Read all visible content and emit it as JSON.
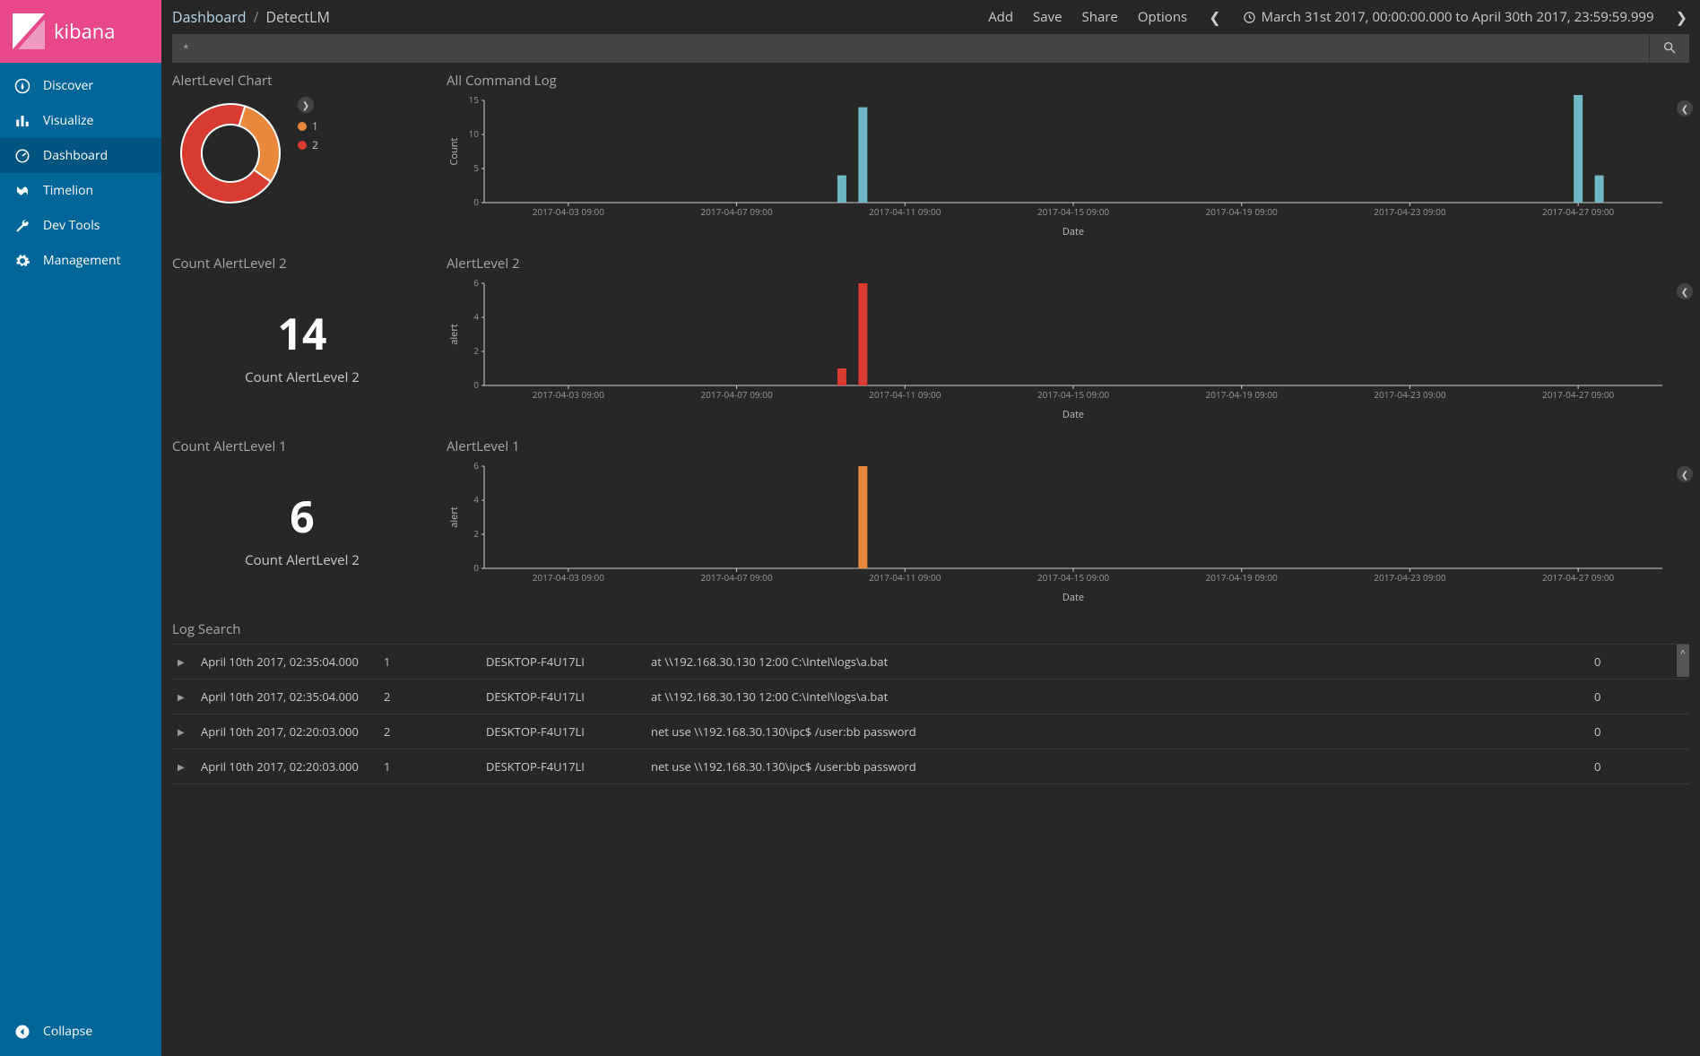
{
  "brand": "kibana",
  "nav": {
    "items": [
      {
        "label": "Discover",
        "icon": "compass"
      },
      {
        "label": "Visualize",
        "icon": "barchart"
      },
      {
        "label": "Dashboard",
        "icon": "dashboard",
        "active": true
      },
      {
        "label": "Timelion",
        "icon": "timelion"
      },
      {
        "label": "Dev Tools",
        "icon": "wrench"
      },
      {
        "label": "Management",
        "icon": "gear"
      }
    ],
    "collapse": "Collapse"
  },
  "breadcrumb": {
    "root": "Dashboard",
    "current": "DetectLM"
  },
  "top_actions": [
    "Add",
    "Save",
    "Share",
    "Options"
  ],
  "timerange": "March 31st 2017, 00:00:00.000 to April 30th 2017, 23:59:59.999",
  "search": {
    "value": "*"
  },
  "panels": {
    "donut": {
      "title": "AlertLevel Chart",
      "legend": [
        {
          "label": "1",
          "color": "#e9873c"
        },
        {
          "label": "2",
          "color": "#d93b30"
        }
      ]
    },
    "all_cmd": {
      "title": "All Command Log",
      "ylabel": "Count",
      "xlabel": "Date"
    },
    "count2": {
      "title": "Count AlertLevel 2",
      "value": "14",
      "label": "Count AlertLevel 2"
    },
    "alert2": {
      "title": "AlertLevel 2",
      "ylabel": "alert",
      "xlabel": "Date"
    },
    "count1": {
      "title": "Count AlertLevel 1",
      "value": "6",
      "label": "Count AlertLevel 2"
    },
    "alert1": {
      "title": "AlertLevel 1",
      "ylabel": "alert",
      "xlabel": "Date"
    },
    "log": {
      "title": "Log Search",
      "rows": [
        {
          "time": "April 10th 2017, 02:35:04.000",
          "level": "1",
          "host": "DESKTOP-F4U17LI",
          "cmd": "at \\\\192.168.30.130 12:00 C:\\Intel\\logs\\a.bat",
          "n": "0"
        },
        {
          "time": "April 10th 2017, 02:35:04.000",
          "level": "2",
          "host": "DESKTOP-F4U17LI",
          "cmd": "at \\\\192.168.30.130 12:00 C:\\Intel\\logs\\a.bat",
          "n": "0"
        },
        {
          "time": "April 10th 2017, 02:20:03.000",
          "level": "2",
          "host": "DESKTOP-F4U17LI",
          "cmd": "net use \\\\192.168.30.130\\ipc$ /user:bb password",
          "n": "0"
        },
        {
          "time": "April 10th 2017, 02:20:03.000",
          "level": "1",
          "host": "DESKTOP-F4U17LI",
          "cmd": "net use \\\\192.168.30.130\\ipc$ /user:bb password",
          "n": "0"
        }
      ]
    }
  },
  "chart_data": [
    {
      "id": "donut",
      "type": "pie",
      "title": "AlertLevel Chart",
      "series": [
        {
          "name": "1",
          "value": 6,
          "color": "#e9873c"
        },
        {
          "name": "2",
          "value": 14,
          "color": "#d93b30"
        }
      ]
    },
    {
      "id": "all_cmd",
      "type": "bar",
      "title": "All Command Log",
      "xlabel": "Date",
      "ylabel": "Count",
      "ylim": [
        0,
        15
      ],
      "yticks": [
        0,
        5,
        10,
        15
      ],
      "x_tick_labels": [
        "2017-04-03 09:00",
        "2017-04-07 09:00",
        "2017-04-11 09:00",
        "2017-04-15 09:00",
        "2017-04-19 09:00",
        "2017-04-23 09:00",
        "2017-04-27 09:00"
      ],
      "bars": [
        {
          "x": "2017-04-09 21:00",
          "y": 4,
          "color": "#6fb7c5"
        },
        {
          "x": "2017-04-10 09:00",
          "y": 14,
          "color": "#6fb7c5"
        },
        {
          "x": "2017-04-27 09:00",
          "y": 16,
          "color": "#6fb7c5"
        },
        {
          "x": "2017-04-27 21:00",
          "y": 4,
          "color": "#6fb7c5"
        }
      ]
    },
    {
      "id": "alert2",
      "type": "bar",
      "title": "AlertLevel 2",
      "xlabel": "Date",
      "ylabel": "alert",
      "ylim": [
        0,
        6
      ],
      "yticks": [
        0,
        2,
        4,
        6
      ],
      "x_tick_labels": [
        "2017-04-03 09:00",
        "2017-04-07 09:00",
        "2017-04-11 09:00",
        "2017-04-15 09:00",
        "2017-04-19 09:00",
        "2017-04-23 09:00",
        "2017-04-27 09:00"
      ],
      "bars": [
        {
          "x": "2017-04-09 21:00",
          "y": 1,
          "color": "#d93b30"
        },
        {
          "x": "2017-04-10 09:00",
          "y": 6,
          "color": "#d93b30"
        }
      ]
    },
    {
      "id": "alert1",
      "type": "bar",
      "title": "AlertLevel 1",
      "xlabel": "Date",
      "ylabel": "alert",
      "ylim": [
        0,
        6
      ],
      "yticks": [
        0,
        2,
        4,
        6
      ],
      "x_tick_labels": [
        "2017-04-03 09:00",
        "2017-04-07 09:00",
        "2017-04-11 09:00",
        "2017-04-15 09:00",
        "2017-04-19 09:00",
        "2017-04-23 09:00",
        "2017-04-27 09:00"
      ],
      "bars": [
        {
          "x": "2017-04-10 09:00",
          "y": 6,
          "color": "#e9873c"
        }
      ]
    }
  ]
}
